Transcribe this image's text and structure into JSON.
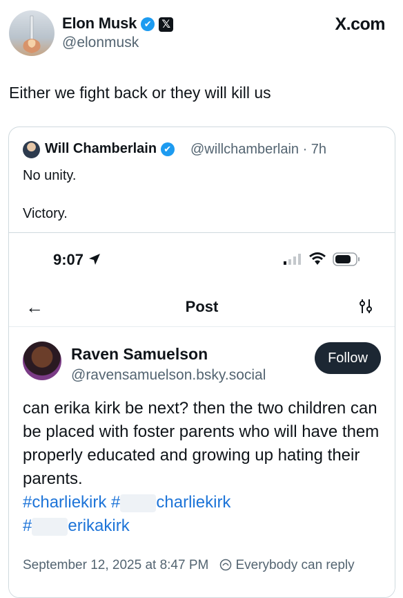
{
  "author": {
    "name": "Elon Musk",
    "handle": "@elonmusk",
    "verified_glyph": "✔",
    "x_badge": "𝕏"
  },
  "site_label": "X.com",
  "tweet": {
    "text": "Either we fight back or they will kill us"
  },
  "quote": {
    "name": "Will Chamberlain",
    "handle_time": "@willchamberlain · 7h",
    "line1": "No unity.",
    "line2": "Victory."
  },
  "screenshot": {
    "time": "9:07",
    "title": "Post",
    "post": {
      "name": "Raven Samuelson",
      "handle": "@ravensamuelson.bsky.social",
      "follow_label": "Follow",
      "body": "can erika kirk be next? then the two children can be placed with foster parents who will have them properly educated and growing up hating their parents.",
      "tag1": "#charliekirk",
      "tag2_prefix": "#",
      "tag2_suffix": "charliekirk",
      "tag3_prefix": "#",
      "tag3_suffix": "erikakirk",
      "timestamp": "September 12, 2025 at 8:47 PM",
      "reply_setting": "Everybody can reply"
    }
  },
  "colors": {
    "link": "#1d74d8",
    "verified": "#1d9bf0",
    "follow_bg": "#1c2733"
  }
}
